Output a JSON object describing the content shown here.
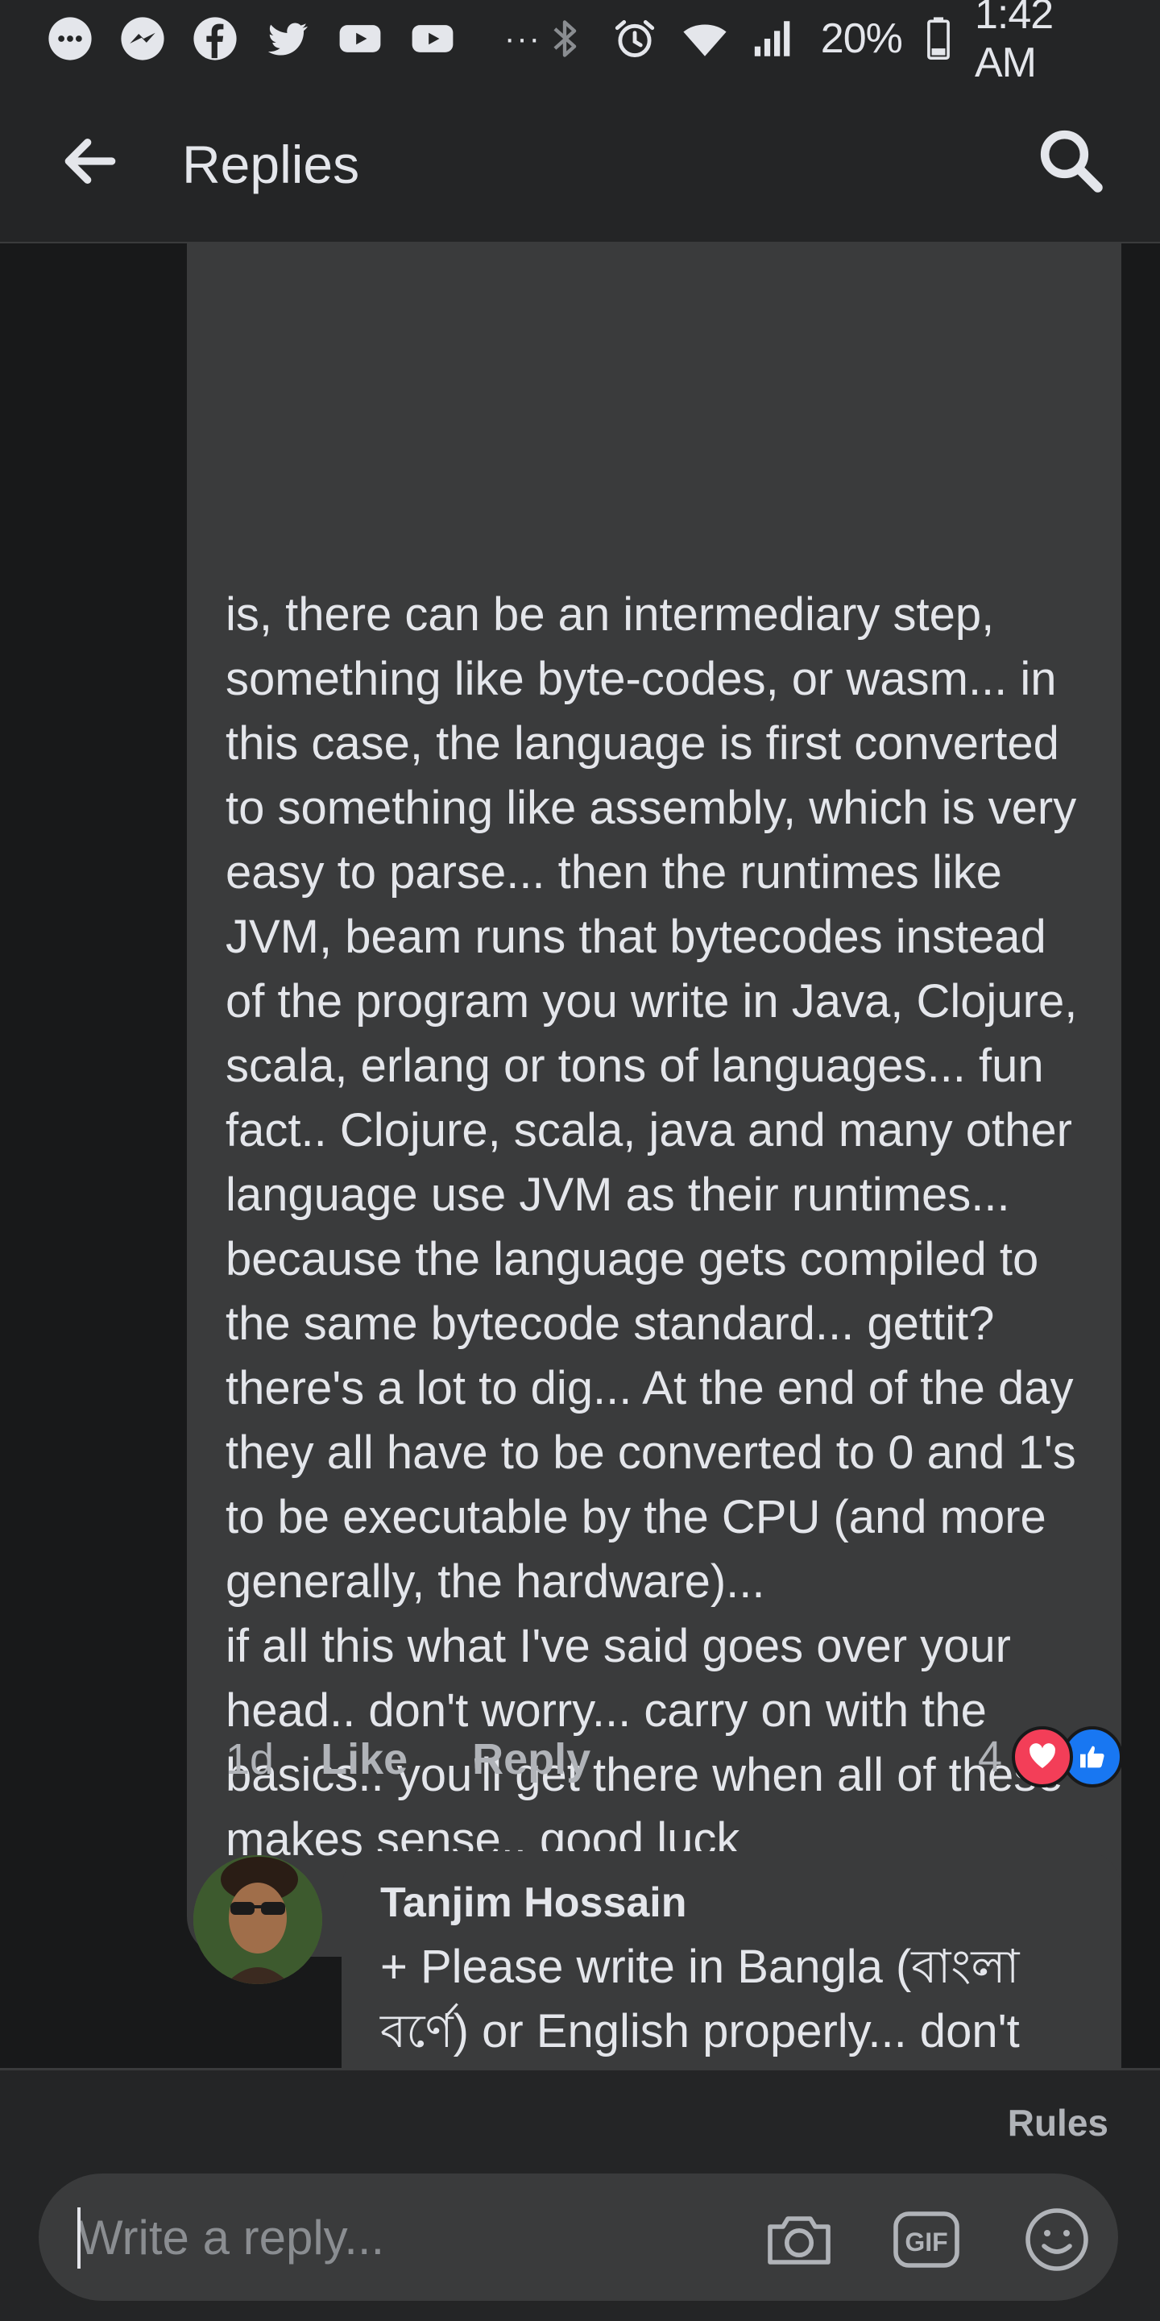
{
  "status_bar": {
    "battery_percent": "20%",
    "time": "1:42 AM",
    "overflow": "···"
  },
  "header": {
    "title": "Replies"
  },
  "comment": {
    "paragraphs": [
      "is, there can be an intermediary step, something like byte-codes, or wasm... in this case, the language is first converted to something like assembly, which is very easy to parse... then the runtimes like JVM, beam runs that bytecodes instead of the program you write in Java, Clojure, scala, erlang or tons of languages... fun fact.. Clojure, scala, java and many other language use JVM as their runtimes... because the language gets compiled to the same bytecode standard... gettit? there's a lot to dig... At the end of the day they all have to be converted to 0 and 1's to be executable by the CPU (and more generally, the hardware)...",
      "if all this what I've said goes over your head.. don't worry... carry on with the basics.. you'll get there when all of these makes sense.. good luck"
    ],
    "time": "1d",
    "like_label": "Like",
    "reply_label": "Reply",
    "reaction_count": "4"
  },
  "reply": {
    "author": "Tanjim Hossain",
    "text": "+ Please write in Bangla (বাংলা বর্ণে) or English properly... don't"
  },
  "composer": {
    "rules_label": "Rules",
    "placeholder": "Write a reply..."
  },
  "colors": {
    "background": "#18191a",
    "surface": "#242526",
    "bubble": "#3a3b3c",
    "love": "#f33e58",
    "like": "#1877f2"
  }
}
